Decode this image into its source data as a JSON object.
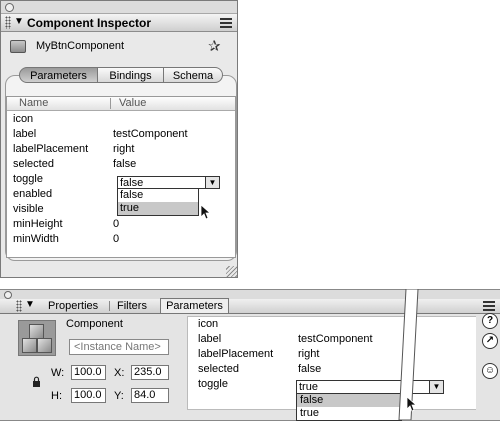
{
  "component_inspector": {
    "title": "Component Inspector",
    "component_name": "MyBtnComponent",
    "tabs": [
      "Parameters",
      "Bindings",
      "Schema"
    ],
    "active_tab": "Parameters",
    "columns": {
      "name": "Name",
      "value": "Value"
    },
    "parameters": [
      {
        "name": "icon",
        "value": ""
      },
      {
        "name": "label",
        "value": "testComponent"
      },
      {
        "name": "labelPlacement",
        "value": "right"
      },
      {
        "name": "selected",
        "value": "false"
      },
      {
        "name": "toggle",
        "value": "false"
      },
      {
        "name": "enabled",
        "value": ""
      },
      {
        "name": "visible",
        "value": ""
      },
      {
        "name": "minHeight",
        "value": "0"
      },
      {
        "name": "minWidth",
        "value": "0"
      }
    ],
    "toggle_dropdown": {
      "selected": "false",
      "options": [
        "false",
        "true"
      ],
      "highlighted": "true"
    }
  },
  "property_inspector": {
    "tabs": [
      "Properties",
      "Filters",
      "Parameters"
    ],
    "active_tab": "Parameters",
    "component_type": "Component",
    "instance_name_placeholder": "<Instance Name>",
    "w_label": "W:",
    "w_value": "100.0",
    "h_label": "H:",
    "h_value": "100.0",
    "x_label": "X:",
    "x_value": "235.0",
    "y_label": "Y:",
    "y_value": "84.0",
    "parameters": [
      {
        "name": "icon",
        "value": ""
      },
      {
        "name": "label",
        "value": "testComponent"
      },
      {
        "name": "labelPlacement",
        "value": "right"
      },
      {
        "name": "selected",
        "value": "false"
      },
      {
        "name": "toggle",
        "value": ""
      }
    ],
    "toggle_dropdown": {
      "selected": "true",
      "options": [
        "false",
        "true"
      ],
      "highlighted": "false"
    },
    "side_icons": [
      "help-icon",
      "edit-icon",
      "accessibility-icon"
    ]
  }
}
